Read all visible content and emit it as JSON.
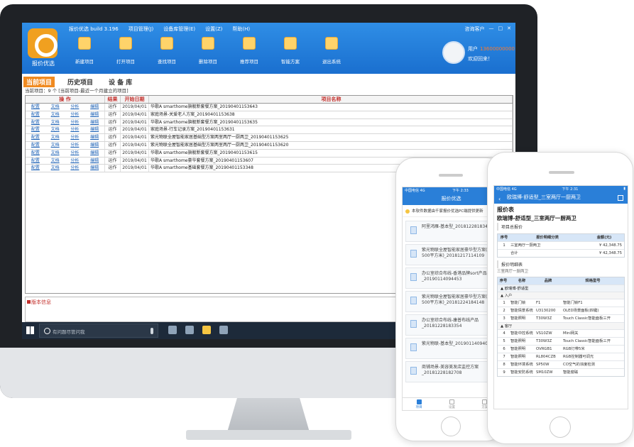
{
  "desktop_app": {
    "logo_text": "报价优选",
    "menu": [
      "报价优选  build 3.196",
      "项目管理(J)",
      "设备库管理(E)",
      "设置(Z)",
      "帮助(H)"
    ],
    "window_controls": [
      "咨询客户",
      "—",
      "□",
      "✕"
    ],
    "tools": [
      "新建项目",
      "打开项目",
      "查找项目",
      "删除项目",
      "推荐项目",
      "智能方案",
      "退出系统"
    ],
    "user": {
      "label": "用户",
      "phone": "13600000000",
      "welcome": "欢迎回来！"
    },
    "tabs": [
      "当前项目",
      "历史项目",
      "设 备 库"
    ],
    "subinfo": "当前项目：9 个   [当前项目-最近一个月建立的项目]",
    "table": {
      "headers": [
        "操  作",
        "结果",
        "开始日期",
        "项目名称"
      ],
      "actions": [
        "配置",
        "文档",
        "分析",
        "编辑"
      ],
      "rows": [
        {
          "status": "运作",
          "date": "2019/04/01",
          "name": "华歌A smarthome旗舰新套餐方案_20190401153643"
        },
        {
          "status": "运作",
          "date": "2019/04/01",
          "name": "家庭场景-关爱老人方案_20190401153638"
        },
        {
          "status": "运作",
          "date": "2019/04/01",
          "name": "华歌A smarthome旗舰新套餐方案_20190401153635"
        },
        {
          "status": "运作",
          "date": "2019/04/01",
          "name": "家庭场景-行车记录方案_20190401153631"
        },
        {
          "status": "运作",
          "date": "2019/04/01",
          "name": "紫光物联全屋智能家居基础型方案两室两厅一厨两卫_20190401153625"
        },
        {
          "status": "运作",
          "date": "2019/04/01",
          "name": "紫光物联全屋智能家居基础型方案两室两厅一厨两卫_20190401153620"
        },
        {
          "status": "运作",
          "date": "2019/04/01",
          "name": "华歌A smarthome旗舰新套餐方案_20190401153615"
        },
        {
          "status": "运作",
          "date": "2019/04/01",
          "name": "华歌A smarthome豪华套餐方案_20190401153607"
        },
        {
          "status": "运作",
          "date": "2019/04/01",
          "name": "华歌A smarthome基础套餐方案_20190401153348"
        }
      ]
    },
    "info_label": "版本信息"
  },
  "taskbar": {
    "search_placeholder": "有问题尽管问我"
  },
  "phone1": {
    "status_left": "中国电信  4G",
    "status_time": "下午 2:33",
    "title": "报价优选",
    "notice": "本软件数据由千家报价优选PC端提供更新",
    "items": [
      [
        "阿里鸿雁-基本型_20181228183412"
      ],
      [
        "紫光物联全屋智能家居豪华型方案(",
        "500平方米)_20181217114109"
      ],
      [
        "办公室综合布线-香港品牌sort产品",
        "_20190114094453"
      ],
      [
        "紫光物联全屋智能家居豪华型方案(",
        "500平方米)_20181224184148"
      ],
      [
        "办公室综合布线-康普布线产品",
        "_20181228183354"
      ],
      [
        "紫光物联-基本型_20190114094056"
      ],
      [
        "商铺场景-美容美发店监控方案",
        "_20181228182708"
      ]
    ],
    "nav": [
      "项目",
      "设置",
      "方案"
    ]
  },
  "phone2": {
    "status_left": "中国电信  4G",
    "status_time": "下午 2:31",
    "title": "欧瑞博-舒适型_三室两厅一厨两卫",
    "h1": "报价表",
    "h2": "欧瑞博-舒适型_三室两厅一厨两卫",
    "sec1": "项目总报价",
    "sum_headers": [
      "序号",
      "报价明细分类",
      "金额(元)"
    ],
    "sum_rows": [
      [
        "1",
        "三室两厅一厨两卫",
        "¥ 42,348.75"
      ],
      [
        "",
        "合计",
        "¥ 42,348.75"
      ]
    ],
    "sec2": "报价明细表",
    "sec2_sub": "三室两厅一厨两卫",
    "detail_headers": [
      "序号",
      "名称",
      "品牌",
      "规格型号"
    ],
    "groups": [
      {
        "label": "▲  欧瑞博-舒适型",
        "sub": "▲  入户",
        "rows": [
          [
            "1",
            "智能门锁",
            "F1",
            "智能门锁F1"
          ],
          [
            "2",
            "智能情景系统",
            "U3130200",
            "OLED场景面板(四键)"
          ],
          [
            "3",
            "智能照明",
            "T30W3Z",
            "Touch Classic智能面板三开"
          ]
        ]
      },
      {
        "label": "",
        "sub": "▲  客厅",
        "rows": [
          [
            "4",
            "智能中控系统",
            "VS10ZW",
            "Mini网关"
          ],
          [
            "5",
            "智能照明",
            "T30W3Z",
            "Touch Classic智能面板三开"
          ],
          [
            "6",
            "智能照明",
            "OVRGB1",
            "RGB灯带5米"
          ],
          [
            "7",
            "智能照明",
            "RL804CZB",
            "RGB控制器可调光"
          ],
          [
            "8",
            "智能环境系统",
            "SP50W",
            "CO空气的浓度检测"
          ],
          [
            "9",
            "智能安防系统",
            "SM10ZW",
            "智能窗磁"
          ]
        ]
      }
    ]
  }
}
